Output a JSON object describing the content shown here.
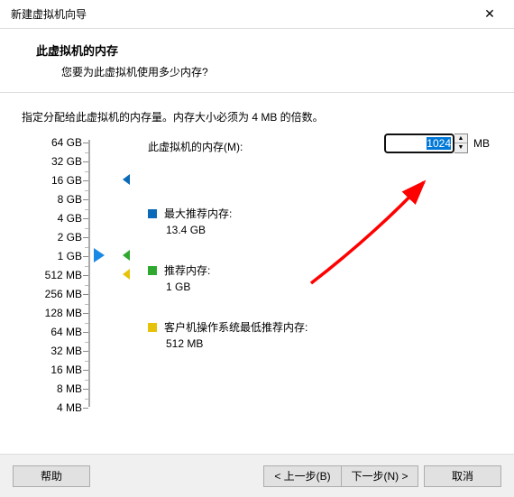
{
  "window": {
    "title": "新建虚拟机向导"
  },
  "header": {
    "title": "此虚拟机的内存",
    "subtitle": "您要为此虚拟机使用多少内存?"
  },
  "instruction": "指定分配给此虚拟机的内存量。内存大小必须为 4 MB 的倍数。",
  "memory": {
    "label": "此虚拟机的内存(M):",
    "value": "1024",
    "unit": "MB"
  },
  "scale": {
    "labels": [
      "64 GB",
      "32 GB",
      "16 GB",
      "8 GB",
      "4 GB",
      "2 GB",
      "1 GB",
      "512 MB",
      "256 MB",
      "128 MB",
      "64 MB",
      "32 MB",
      "16 MB",
      "8 MB",
      "4 MB"
    ]
  },
  "markers": {
    "max": {
      "title": "最大推荐内存:",
      "value": "13.4 GB"
    },
    "rec": {
      "title": "推荐内存:",
      "value": "1 GB"
    },
    "min": {
      "title": "客户机操作系统最低推荐内存:",
      "value": "512 MB"
    }
  },
  "buttons": {
    "help": "帮助",
    "back": "< 上一步(B)",
    "next": "下一步(N) >",
    "cancel": "取消"
  }
}
